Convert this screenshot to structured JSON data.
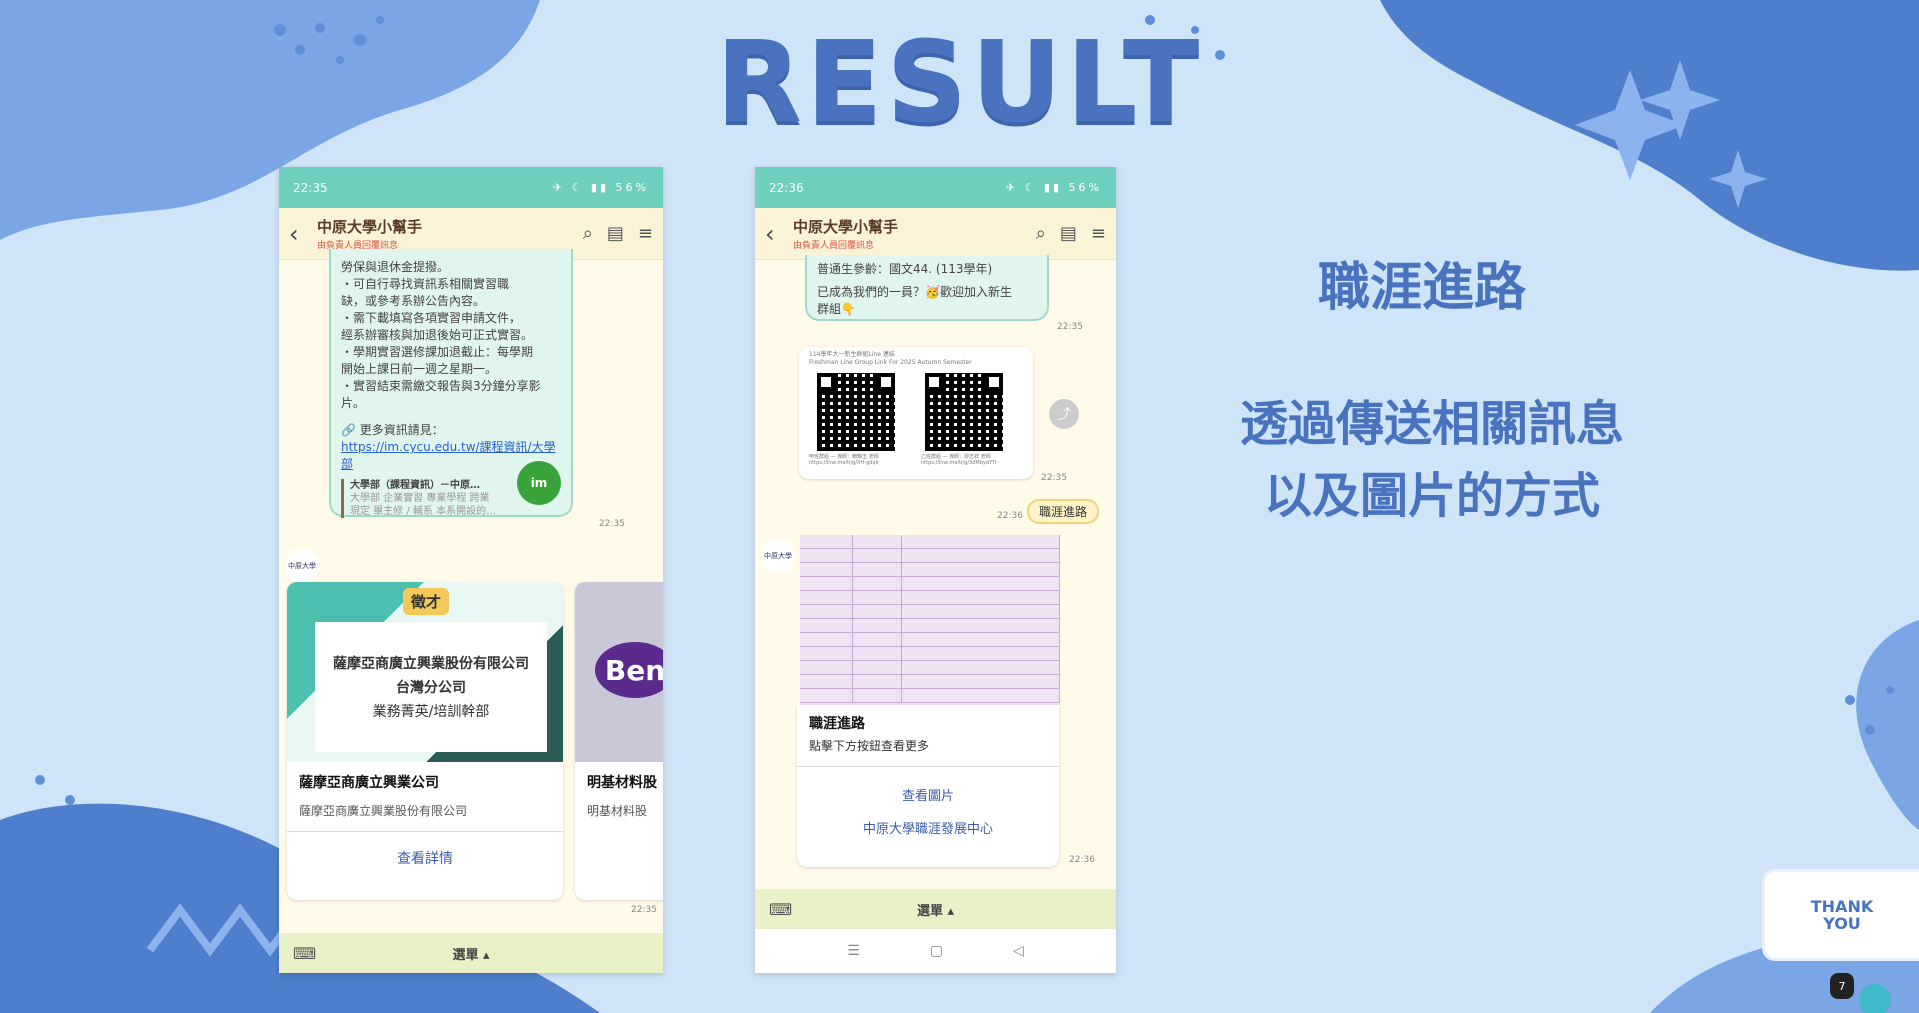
{
  "slide": {
    "title": "RESULT",
    "heading": "職涯進路",
    "body_line1": "透過傳送相關訊息",
    "body_line2": "以及圖片的方式",
    "thank_you_line1": "THANK",
    "thank_you_line2": "YOU",
    "page_number": "7"
  },
  "colors": {
    "accent": "#4a73bf",
    "teal": "#6fcfbf",
    "bg": "#cfe4f7"
  },
  "phone1": {
    "status_time": "22:35",
    "status_battery": "56%",
    "chat_title": "中原大學小幫手",
    "chat_subtitle": "由負責人員回覆訊息",
    "msg_line0": "勞保與退休金提撥。",
    "msg_line1": "・可自行尋找資訊系相關實習職",
    "msg_line2": "缺，或參考系辦公告內容。",
    "msg_line3": "・需下載填寫各項實習申請文件，",
    "msg_line4": "經系辦審核與加退後始可正式實習。",
    "msg_line5": "・學期實習選修課加退截止：每學期",
    "msg_line6": "開始上課日前一週之星期一。",
    "msg_line7": "・實習結束需繳交報告與3分鐘分享影",
    "msg_line8": "片。",
    "more_info": "🔗 更多資訊請見：",
    "link": "https://im.cycu.edu.tw/課程資訊/大學部",
    "preview_title": "大學部（課程資訊）－中原…",
    "preview_desc1": "大學部 企業實習 專業學程 跨業",
    "preview_desc2": "現定 畢主修 / 輔系 本系開設的…",
    "msg_time": "22:35",
    "card1_badge": "徵才",
    "card1_company_line1": "薩摩亞商廣立興業股份有限公司",
    "card1_company_line2": "台灣分公司",
    "card1_dept": "業務菁英/培訓幹部",
    "card1_title": "薩摩亞商廣立興業公司",
    "card1_sub": "薩摩亞商廣立興業股份有限公司",
    "card1_button": "查看詳情",
    "card2_logo": "Ben",
    "card2_title": "明基材料股",
    "card2_sub": "明基材料股",
    "card_time": "22:35",
    "menu_label": "選單 ▴"
  },
  "phone2": {
    "status_time": "22:36",
    "status_battery": "56%",
    "chat_title": "中原大學小幫手",
    "chat_subtitle": "由負責人員回覆訊息",
    "msg_line1": "普通生參齡：國文44. (113學年)",
    "msg_line2": "已成為我們的一員？🥳歡迎加入新生",
    "msg_line3": "群組👇",
    "msg_time": "22:35",
    "qr_header1": "114學年大一新生群組Line 連結",
    "qr_header2": "Freshman Line Group Link For 2025 Autumn Semester",
    "qr_left_caption": "甲班群組 — 導師：賴錦玉 老師",
    "qr_left_link": "https://line.me/ti/g/XH-gdqlr",
    "qr_right_caption": "乙班群組 — 導師：廖志祥 老師",
    "qr_right_link": "https://line.me/ti/g/3dMbyd7Tr",
    "qr_time": "22:35",
    "user_msg": "職涯進路",
    "user_time": "22:36",
    "card_title": "職涯進路",
    "card_sub": "點擊下方按鈕查看更多",
    "card_btn1": "查看圖片",
    "card_btn2": "中原大學職涯發展中心",
    "card_time": "22:36",
    "menu_label": "選單 ▴"
  }
}
